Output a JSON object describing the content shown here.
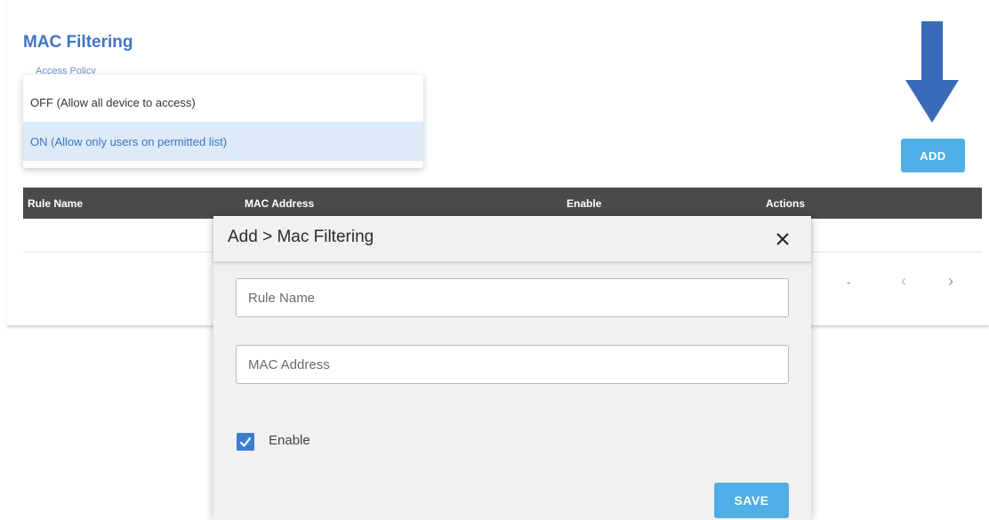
{
  "page": {
    "title": "MAC Filtering",
    "access_policy_label": "Access Policy"
  },
  "policy_dropdown": {
    "options": [
      {
        "label": "OFF (Allow all device to access)",
        "selected": false
      },
      {
        "label": "ON (Allow only users on permitted list)",
        "selected": true
      }
    ]
  },
  "toolbar": {
    "add_label": "ADD"
  },
  "table": {
    "columns": [
      "Rule Name",
      "MAC Address",
      "Enable",
      "Actions"
    ]
  },
  "pagination": {
    "range_text": "-",
    "prev_glyph": "‹",
    "next_glyph": "›"
  },
  "dialog": {
    "title": "Add > Mac Filtering",
    "close_glyph": "✕",
    "rule_name_placeholder": "Rule Name",
    "mac_address_placeholder": "MAC Address",
    "enable_label": "Enable",
    "enable_checked": true,
    "save_label": "SAVE"
  },
  "colors": {
    "accent": "#3f74c4",
    "button": "#4faee6",
    "table_header": "#4a4a4a",
    "annotation_arrow": "#3a6bb8"
  }
}
